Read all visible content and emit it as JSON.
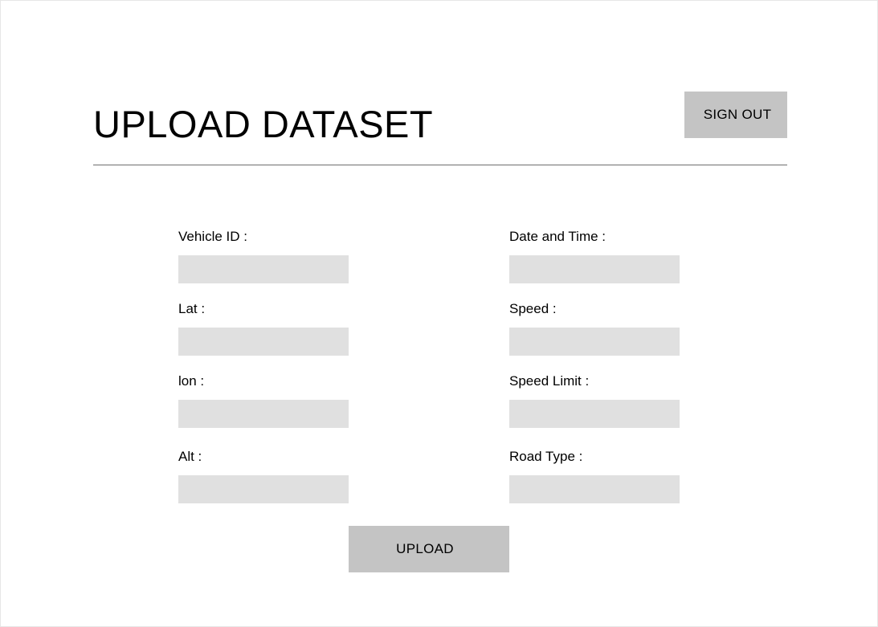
{
  "header": {
    "title": "UPLOAD DATASET",
    "sign_out_label": "SIGN OUT"
  },
  "form": {
    "vehicle_id": {
      "label": "Vehicle ID :",
      "value": ""
    },
    "date_time": {
      "label": "Date and Time :",
      "value": ""
    },
    "lat": {
      "label": "Lat :",
      "value": ""
    },
    "speed": {
      "label": "Speed :",
      "value": ""
    },
    "lon": {
      "label": "lon :",
      "value": ""
    },
    "speed_limit": {
      "label": "Speed Limit :",
      "value": ""
    },
    "alt": {
      "label": "Alt :",
      "value": ""
    },
    "road_type": {
      "label": "Road Type :",
      "value": ""
    },
    "upload_label": "UPLOAD"
  },
  "colors": {
    "button_bg": "#c4c4c4",
    "input_bg": "#e0e0e0",
    "divider": "#6e6e6e",
    "text": "#000000"
  }
}
